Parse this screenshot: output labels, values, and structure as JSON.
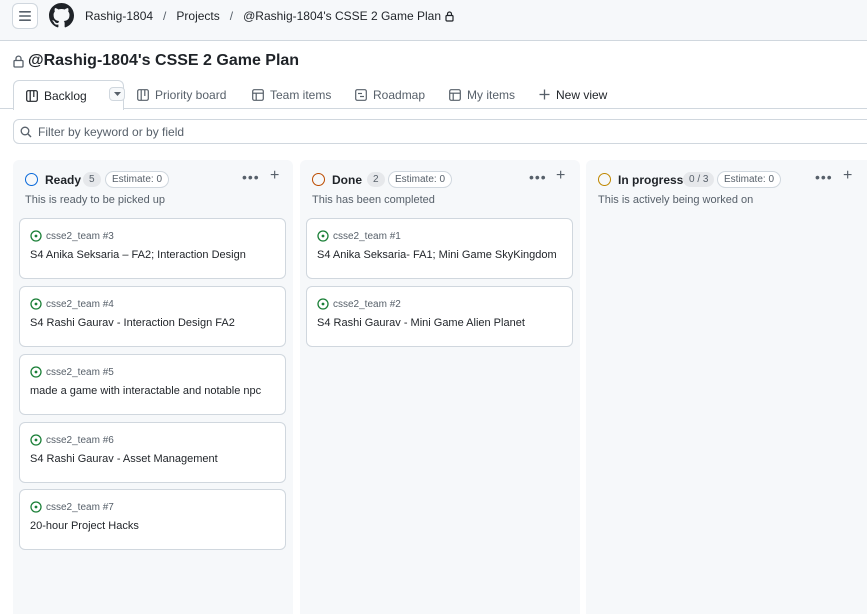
{
  "header": {
    "breadcrumbs": [
      "Rashig-1804",
      "Projects",
      "@Rashig-1804's CSSE 2 Game Plan"
    ]
  },
  "project": {
    "title": "@Rashig-1804's CSSE 2 Game Plan"
  },
  "views": {
    "tabs": [
      {
        "label": "Backlog",
        "icon": "board-icon"
      },
      {
        "label": "Priority board",
        "icon": "board-icon"
      },
      {
        "label": "Team items",
        "icon": "table-icon"
      },
      {
        "label": "Roadmap",
        "icon": "roadmap-icon"
      },
      {
        "label": "My items",
        "icon": "table-icon"
      }
    ],
    "new_view_label": "New view"
  },
  "filter": {
    "placeholder": "Filter by keyword or by field"
  },
  "columns": [
    {
      "name": "Ready",
      "count": "5",
      "estimate": "Estimate: 0",
      "description": "This is ready to be picked up",
      "color": "#0969da",
      "cards": [
        {
          "ref": "csse2_team #3",
          "title": "S4 Anika Seksaria – FA2; Interaction Design"
        },
        {
          "ref": "csse2_team #4",
          "title": "S4 Rashi Gaurav - Interaction Design FA2"
        },
        {
          "ref": "csse2_team #5",
          "title": "made a game with interactable and notable npc"
        },
        {
          "ref": "csse2_team #6",
          "title": "S4 Rashi Gaurav - Asset Management"
        },
        {
          "ref": "csse2_team #7",
          "title": "20-hour Project Hacks"
        }
      ]
    },
    {
      "name": "Done",
      "count": "2",
      "estimate": "Estimate: 0",
      "description": "This has been completed",
      "color": "#bc4c00",
      "cards": [
        {
          "ref": "csse2_team #1",
          "title": "S4 Anika Seksaria- FA1; Mini Game SkyKingdom"
        },
        {
          "ref": "csse2_team #2",
          "title": "S4 Rashi Gaurav - Mini Game Alien Planet"
        }
      ]
    },
    {
      "name": "In progress",
      "count": "0 / 3",
      "estimate": "Estimate: 0",
      "description": "This is actively being worked on",
      "color": "#bf8700",
      "cards": []
    }
  ],
  "colors": {
    "open_issue": "#1a7f37",
    "border": "#d0d7de",
    "column_bg": "#f6f8fa"
  }
}
